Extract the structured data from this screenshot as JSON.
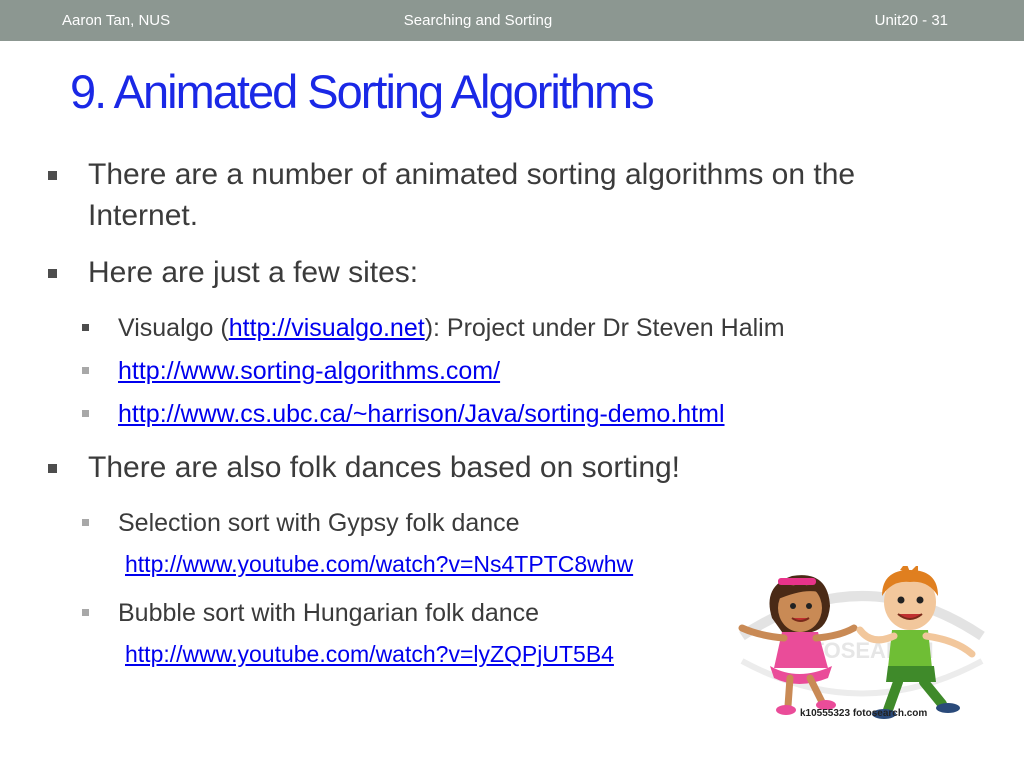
{
  "header": {
    "author": "Aaron Tan,  NUS",
    "topic": "Searching and Sorting",
    "unit": "Unit20 - 31"
  },
  "title": "9. Animated Sorting Algorithms",
  "bullets": {
    "intro_line1": "There are a number of animated sorting algorithms on the",
    "intro_line2": "Internet.",
    "sites_heading": "Here are just a few sites:",
    "visualgo_prefix": "Visualgo (",
    "visualgo_link": "http://visualgo.net",
    "visualgo_suffix": "): Project under Dr Steven Halim",
    "sorting_algorithms_link": "http://www.sorting-algorithms.com/",
    "ubc_link": "http://www.cs.ubc.ca/~harrison/Java/sorting-demo.html",
    "folk_heading": "There are also folk dances based on sorting!",
    "selection_label": "Selection sort with Gypsy folk dance",
    "selection_link": "http://www.youtube.com/watch?v=Ns4TPTC8whw",
    "bubble_label": "Bubble sort with Hungarian folk dance",
    "bubble_link": "http://www.youtube.com/watch?v=lyZQPjUT5B4"
  },
  "image": {
    "watermark": "FOTOSEARCH",
    "caption": "k10555323  fotosearch.com"
  },
  "colors": {
    "header_bar": "#8c9791",
    "title": "#1a28e6",
    "link": "#0000ee",
    "body_text": "#3b3b3b"
  }
}
